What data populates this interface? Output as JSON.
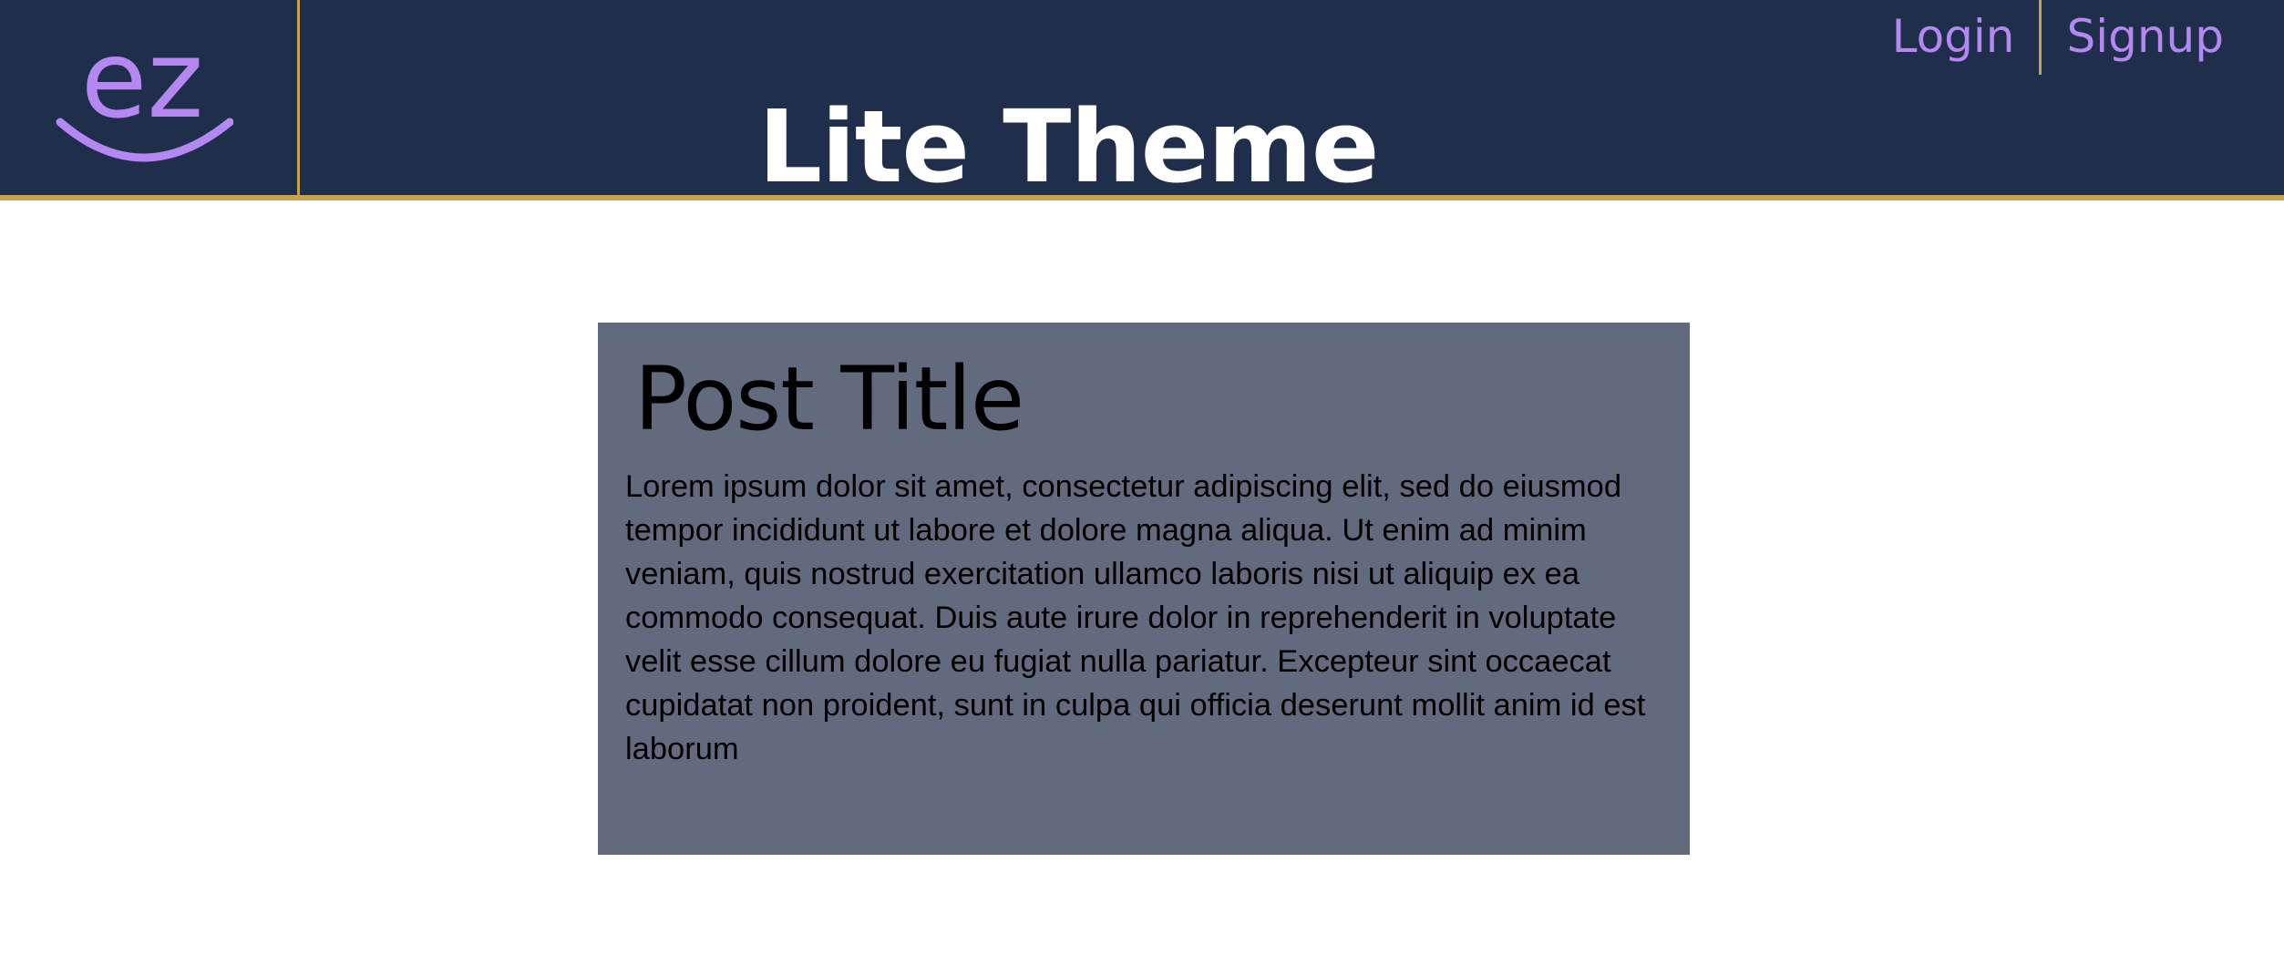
{
  "colors": {
    "header_bg": "#1f2e4a",
    "accent_gold": "#c8a24a",
    "link_purple": "#b587f0",
    "card_bg": "#626a7d"
  },
  "header": {
    "logo_text": "ez",
    "logo_icon": "ez-smile-logo-icon",
    "title": "Lite Theme",
    "nav": {
      "login_label": "Login",
      "signup_label": "Signup"
    }
  },
  "post": {
    "title": "Post Title",
    "body": "Lorem ipsum dolor sit amet, consectetur adipiscing elit, sed do eiusmod tempor incididunt ut labore et dolore magna aliqua. Ut enim ad minim veniam, quis nostrud exercitation ullamco laboris nisi ut aliquip ex ea commodo consequat. Duis aute irure dolor in reprehenderit in voluptate velit esse cillum dolore eu fugiat nulla pariatur. Excepteur sint occaecat cupidatat non proident, sunt in culpa qui officia deserunt mollit anim id est laborum"
  }
}
